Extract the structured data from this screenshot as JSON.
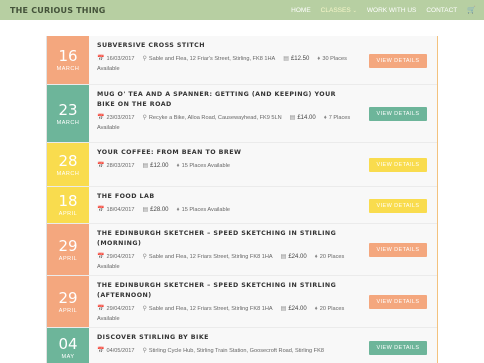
{
  "header": {
    "brand": "THE CURIOUS THING",
    "nav": [
      {
        "label": "HOME"
      },
      {
        "label": "CLASSES"
      },
      {
        "label": "WORK WITH US"
      },
      {
        "label": "CONTACT"
      }
    ],
    "classes_chevron": "⌄",
    "cart_icon": "shopping-cart-icon"
  },
  "colors": {
    "orange": "#f4a77e",
    "green": "#6db59a",
    "yellow": "#f9dc4e"
  },
  "button_label": "VIEW DETAILS",
  "events": [
    {
      "day": "16",
      "month": "MARCH",
      "color": "orange",
      "title": "SUBVERSIVE CROSS STITCH",
      "date": "16/03/2017",
      "venue": "Sable and Flea, 12 Friar's Street, Stirling, FK8 1HA",
      "price": "£12.50",
      "places": "30 Places Available"
    },
    {
      "day": "23",
      "month": "MARCH",
      "color": "green",
      "title": "MUG O' TEA AND A SPANNER: GETTING (AND KEEPING) YOUR BIKE ON THE ROAD",
      "date": "23/03/2017",
      "venue": "Recyke a Bike, Alloa Road, Causewayhead, FK9 5LN",
      "price": "£14.00",
      "places": "7 Places Available"
    },
    {
      "day": "28",
      "month": "MARCH",
      "color": "yellow",
      "title": "YOUR COFFEE: FROM BEAN TO BREW",
      "date": "28/03/2017",
      "venue": "",
      "price": "£12.00",
      "places": "15 Places Available"
    },
    {
      "day": "18",
      "month": "APRIL",
      "color": "yellow",
      "title": "THE FOOD LAB",
      "date": "18/04/2017",
      "venue": "",
      "price": "£28.00",
      "places": "15 Places Available"
    },
    {
      "day": "29",
      "month": "APRIL",
      "color": "orange",
      "title": "THE EDINBURGH SKETCHER – SPEED SKETCHING IN STIRLING (MORNING)",
      "date": "29/04/2017",
      "venue": "Sable and Flea, 12 Friars Street, Stirling FK8 1HA",
      "price": "£24.00",
      "places": "20 Places Available"
    },
    {
      "day": "29",
      "month": "APRIL",
      "color": "orange",
      "title": "THE EDINBURGH SKETCHER – SPEED SKETCHING IN STIRLING (AFTERNOON)",
      "date": "29/04/2017",
      "venue": "Sable and Flea, 12 Friars Street, Stirling FK8 1HA",
      "price": "£24.00",
      "places": "20 Places Available"
    },
    {
      "day": "04",
      "month": "MAY",
      "color": "green",
      "title": "DISCOVER STIRLING BY BIKE",
      "date": "04/05/2017",
      "venue": "Stirling Cycle Hub, Stirling Train Station, Goosecroft Road, Stirling FK8",
      "price": "",
      "places": ""
    }
  ]
}
